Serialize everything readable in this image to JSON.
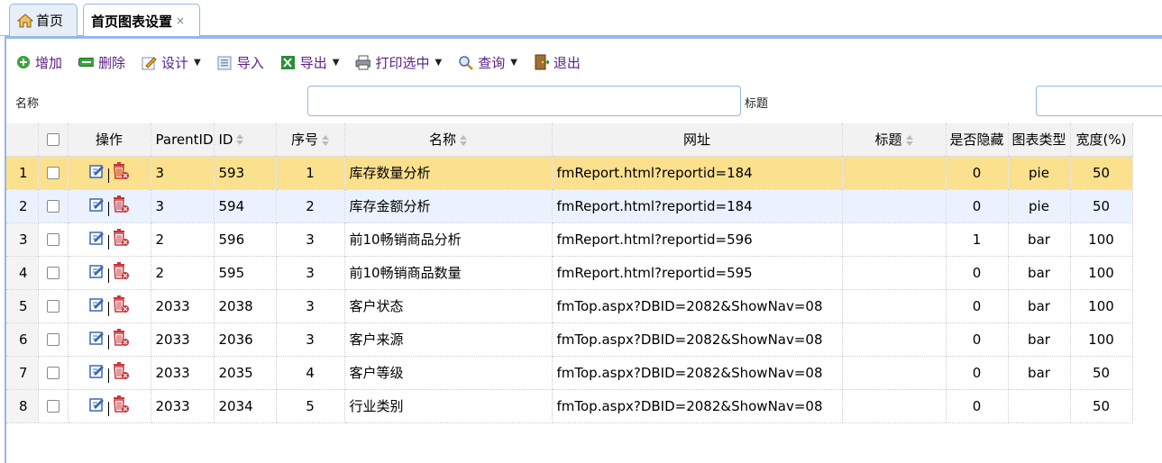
{
  "tabs": [
    {
      "label": "首页"
    },
    {
      "label": "首页图表设置",
      "close": "×"
    }
  ],
  "toolbar": {
    "add": "增加",
    "delete": "删除",
    "design": "设计",
    "import": "导入",
    "export": "导出",
    "print": "打印选中",
    "query": "查询",
    "exit": "退出"
  },
  "search": {
    "name_label": "名称",
    "name_value": "",
    "title_label": "标题",
    "title_value": ""
  },
  "grid": {
    "headers": {
      "ops": "操作",
      "parentid": "ParentID",
      "id": "ID",
      "seq": "序号",
      "name": "名称",
      "url": "网址",
      "title": "标题",
      "hidden": "是否隐藏",
      "chart_type": "图表类型",
      "width": "宽度(%)"
    },
    "rows": [
      {
        "rn": "1",
        "parentid": "3",
        "id": "593",
        "seq": "1",
        "name": "库存数量分析",
        "url": "fmReport.html?reportid=184",
        "title": "",
        "hidden": "0",
        "chart_type": "pie",
        "width": "50"
      },
      {
        "rn": "2",
        "parentid": "3",
        "id": "594",
        "seq": "2",
        "name": "库存金额分析",
        "url": "fmReport.html?reportid=184",
        "title": "",
        "hidden": "0",
        "chart_type": "pie",
        "width": "50"
      },
      {
        "rn": "3",
        "parentid": "2",
        "id": "596",
        "seq": "3",
        "name": "前10畅销商品分析",
        "url": "fmReport.html?reportid=596",
        "title": "",
        "hidden": "1",
        "chart_type": "bar",
        "width": "100"
      },
      {
        "rn": "4",
        "parentid": "2",
        "id": "595",
        "seq": "3",
        "name": "前10畅销商品数量",
        "url": "fmReport.html?reportid=595",
        "title": "",
        "hidden": "0",
        "chart_type": "bar",
        "width": "100"
      },
      {
        "rn": "5",
        "parentid": "2033",
        "id": "2038",
        "seq": "3",
        "name": "客户状态",
        "url": "fmTop.aspx?DBID=2082&ShowNav=08",
        "title": "",
        "hidden": "0",
        "chart_type": "bar",
        "width": "100"
      },
      {
        "rn": "6",
        "parentid": "2033",
        "id": "2036",
        "seq": "3",
        "name": "客户来源",
        "url": "fmTop.aspx?DBID=2082&ShowNav=08",
        "title": "",
        "hidden": "0",
        "chart_type": "bar",
        "width": "100"
      },
      {
        "rn": "7",
        "parentid": "2033",
        "id": "2035",
        "seq": "4",
        "name": "客户等级",
        "url": "fmTop.aspx?DBID=2082&ShowNav=08",
        "title": "",
        "hidden": "0",
        "chart_type": "bar",
        "width": "50"
      },
      {
        "rn": "8",
        "parentid": "2033",
        "id": "2034",
        "seq": "5",
        "name": "行业类别",
        "url": "fmTop.aspx?DBID=2082&ShowNav=08",
        "title": "",
        "hidden": "0",
        "chart_type": "",
        "width": "50"
      }
    ]
  }
}
